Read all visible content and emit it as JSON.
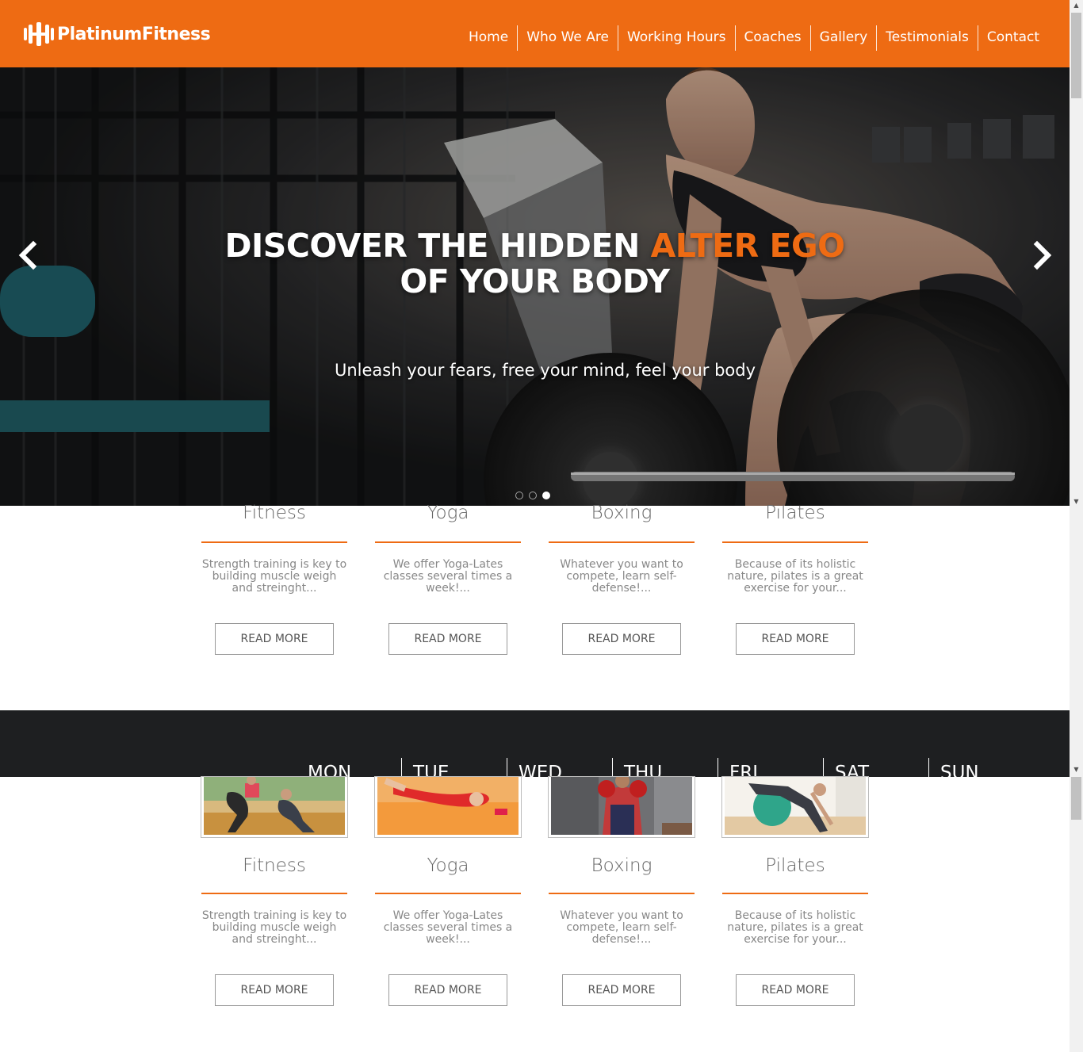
{
  "brand": {
    "name": "PlatinumFitness",
    "accent": "#ee6b13"
  },
  "nav": [
    {
      "label": "Home"
    },
    {
      "label": "Who We Are"
    },
    {
      "label": "Working Hours"
    },
    {
      "label": "Coaches"
    },
    {
      "label": "Gallery"
    },
    {
      "label": "Testimonials"
    },
    {
      "label": "Contact"
    }
  ],
  "hero": {
    "title_part1": "DISCOVER THE HIDDEN ",
    "title_accent": "ALTER EGO",
    "title_part2": "OF YOUR BODY",
    "subtitle": "Unleash your fears, free your mind, feel your body",
    "slide_count": 3,
    "active_slide": 3,
    "prev_icon": "chevron-left-icon",
    "next_icon": "chevron-right-icon"
  },
  "services": [
    {
      "title": "Fitness",
      "text": "Strength training is key to building muscle weigh and streinght...",
      "button": "READ MORE"
    },
    {
      "title": "Yoga",
      "text": "We offer Yoga-Lates classes several times a week!...",
      "button": "READ MORE"
    },
    {
      "title": "Boxing",
      "text": "Whatever you want to compete, learn self-defense!...",
      "button": "READ MORE"
    },
    {
      "title": "Pilates",
      "text": "Because of its holistic nature, pilates is a great exercise for your...",
      "button": "READ MORE"
    }
  ],
  "days": [
    "MON",
    "TUE",
    "WED",
    "THU",
    "FRI",
    "SAT",
    "SUN"
  ]
}
